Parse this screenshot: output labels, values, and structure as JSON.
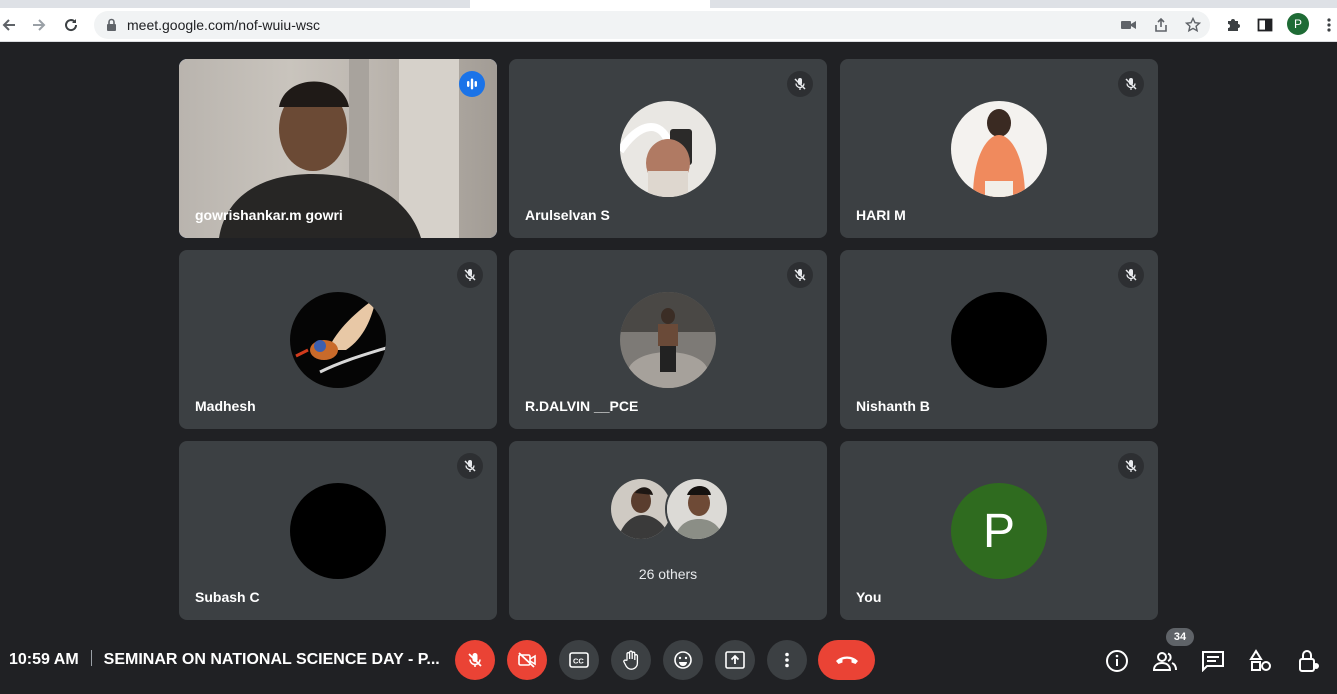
{
  "browser": {
    "url": "meet.google.com/nof-wuiu-wsc",
    "profile_initial": "P"
  },
  "tiles": [
    {
      "name": "gowrishankar.m gowri",
      "speaking": true
    },
    {
      "name": "Arulselvan S",
      "muted": true
    },
    {
      "name": "HARI M",
      "muted": true
    },
    {
      "name": "Madhesh",
      "muted": true
    },
    {
      "name": "R.DALVIN __PCE",
      "muted": true
    },
    {
      "name": "Nishanth B",
      "muted": true
    },
    {
      "name": "Subash C",
      "muted": true
    },
    {
      "name": "26 others"
    },
    {
      "name": "You",
      "initial": "P",
      "muted": true
    }
  ],
  "bottom": {
    "time": "10:59 AM",
    "meeting_title": "SEMINAR ON NATIONAL SCIENCE DAY - P...",
    "participant_count": "34"
  },
  "colors": {
    "background": "#202124",
    "tile": "#3c4043",
    "danger": "#ea4335",
    "speaking": "#8ab4f8",
    "self_avatar": "#2f6b1f"
  }
}
